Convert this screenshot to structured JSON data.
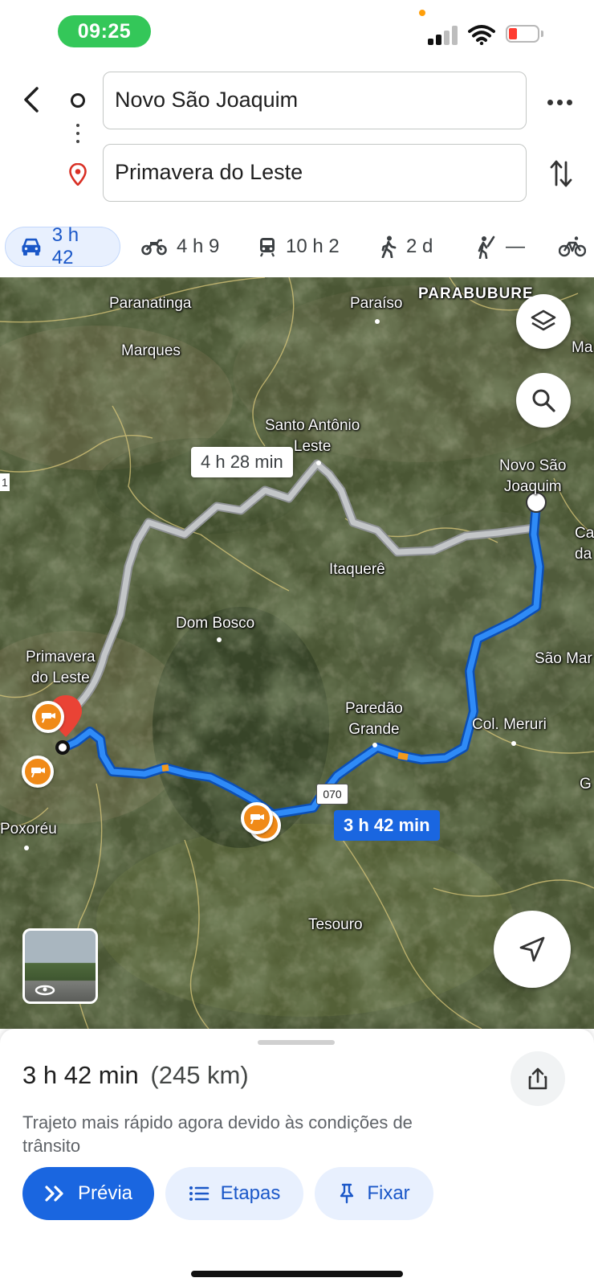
{
  "status_bar": {
    "time": "09:25"
  },
  "route": {
    "origin": "Novo São Joaquim",
    "destination": "Primavera do Leste"
  },
  "modes": [
    {
      "icon": "car-icon",
      "label": "3 h 42",
      "selected": true
    },
    {
      "icon": "motorcycle-icon",
      "label": "4 h 9"
    },
    {
      "icon": "transit-icon",
      "label": "10 h 2"
    },
    {
      "icon": "walk-icon",
      "label": "2 d"
    },
    {
      "icon": "ride-hail-icon",
      "label": "—"
    },
    {
      "icon": "bicycle-icon",
      "label": ""
    }
  ],
  "map": {
    "places": {
      "paranatinga": "Paranatinga",
      "paraiso": "Paraíso",
      "parabubure": "PARABUBURE",
      "ma": "Ma",
      "marques": "Marques",
      "santo_antonio": "Santo Antônio\nLeste",
      "novo_sao_joaquim": "Novo São\nJoaquim",
      "ca": "Ca\nda",
      "itaquere": "Itaquerê",
      "dom_bosco": "Dom Bosco",
      "primavera": "Primavera\ndo Leste",
      "sao_mar": "São Mar",
      "paredao": "Paredão\nGrande",
      "col_meruri": "Col. Meruri",
      "g": "G",
      "poxoreu": "Poxoréu",
      "tesouro": "Tesouro",
      "one": "1"
    },
    "alt_route_time": "4 h 28 min",
    "main_route_time": "3 h 42 min",
    "road_number": "070",
    "colors": {
      "main_route": "#1a73e8",
      "alt_route": "#b8bcbf",
      "camera": "#f08a18"
    }
  },
  "sheet": {
    "duration": "3 h 42 min",
    "distance": "(245 km)",
    "description": "Trajeto mais rápido agora devido às condições de trânsito",
    "buttons": {
      "preview": "Prévia",
      "steps": "Etapas",
      "pin": "Fixar"
    }
  }
}
